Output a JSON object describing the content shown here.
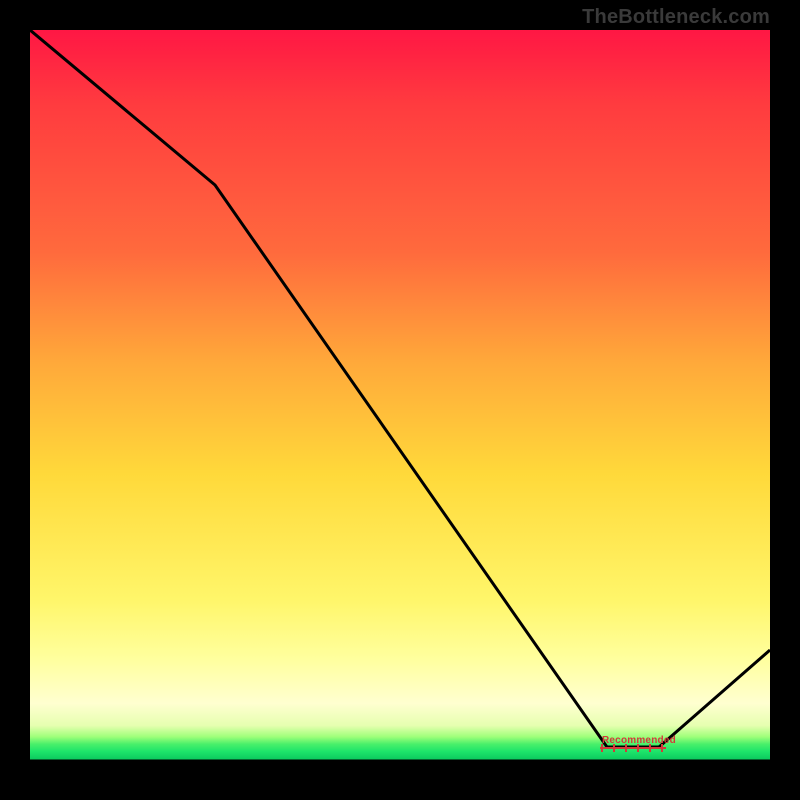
{
  "watermark": "TheBottleneck.com",
  "marker_label": "Recommended",
  "chart_data": {
    "type": "line",
    "title": "",
    "xlabel": "",
    "ylabel": "",
    "ylim": [
      0,
      100
    ],
    "xlim": [
      0,
      100
    ],
    "x": [
      0,
      25,
      78,
      85,
      100
    ],
    "values": [
      100,
      79,
      3,
      3,
      16
    ],
    "annotations": [
      {
        "text": "Recommended",
        "x": 81,
        "y": 3
      }
    ],
    "gradient_stops": [
      {
        "pos": 0.0,
        "color": "#ff1744"
      },
      {
        "pos": 0.3,
        "color": "#ff6a3d"
      },
      {
        "pos": 0.6,
        "color": "#ffd93a"
      },
      {
        "pos": 0.92,
        "color": "#ffffd0"
      },
      {
        "pos": 0.97,
        "color": "#1de46a"
      },
      {
        "pos": 0.986,
        "color": "#0cc95e"
      },
      {
        "pos": 0.986,
        "color": "#000000"
      },
      {
        "pos": 1.0,
        "color": "#000000"
      }
    ]
  }
}
